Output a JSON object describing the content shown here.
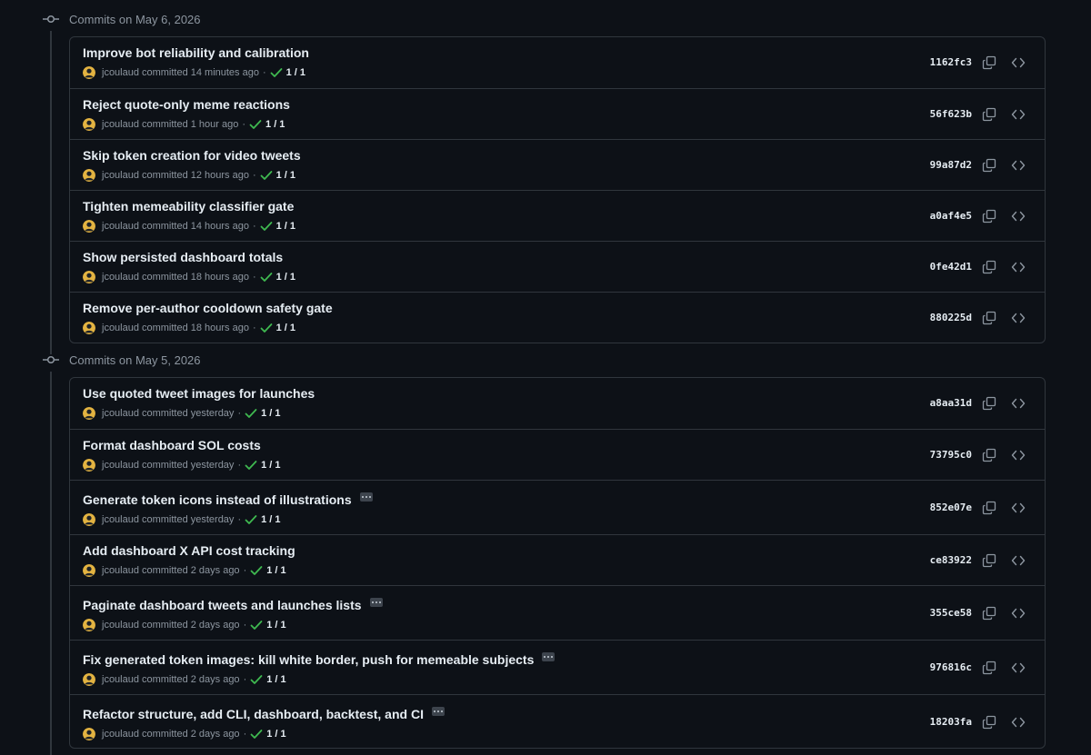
{
  "groups": [
    {
      "label": "Commits on May 6, 2026",
      "commits": [
        {
          "title": "Improve bot reliability and calibration",
          "author": "jcoulaud",
          "committed": "committed",
          "time": "14 minutes ago",
          "sep": "·",
          "status": "1 / 1",
          "sha": "1162fc3",
          "has_ellipsis": false
        },
        {
          "title": "Reject quote-only meme reactions",
          "author": "jcoulaud",
          "committed": "committed",
          "time": "1 hour ago",
          "sep": "·",
          "status": "1 / 1",
          "sha": "56f623b",
          "has_ellipsis": false
        },
        {
          "title": "Skip token creation for video tweets",
          "author": "jcoulaud",
          "committed": "committed",
          "time": "12 hours ago",
          "sep": "·",
          "status": "1 / 1",
          "sha": "99a87d2",
          "has_ellipsis": false
        },
        {
          "title": "Tighten memeability classifier gate",
          "author": "jcoulaud",
          "committed": "committed",
          "time": "14 hours ago",
          "sep": "·",
          "status": "1 / 1",
          "sha": "a0af4e5",
          "has_ellipsis": false
        },
        {
          "title": "Show persisted dashboard totals",
          "author": "jcoulaud",
          "committed": "committed",
          "time": "18 hours ago",
          "sep": "·",
          "status": "1 / 1",
          "sha": "0fe42d1",
          "has_ellipsis": false
        },
        {
          "title": "Remove per-author cooldown safety gate",
          "author": "jcoulaud",
          "committed": "committed",
          "time": "18 hours ago",
          "sep": "·",
          "status": "1 / 1",
          "sha": "880225d",
          "has_ellipsis": false
        }
      ]
    },
    {
      "label": "Commits on May 5, 2026",
      "commits": [
        {
          "title": "Use quoted tweet images for launches",
          "author": "jcoulaud",
          "committed": "committed",
          "time": "yesterday",
          "sep": "·",
          "status": "1 / 1",
          "sha": "a8aa31d",
          "has_ellipsis": false
        },
        {
          "title": "Format dashboard SOL costs",
          "author": "jcoulaud",
          "committed": "committed",
          "time": "yesterday",
          "sep": "·",
          "status": "1 / 1",
          "sha": "73795c0",
          "has_ellipsis": false
        },
        {
          "title": "Generate token icons instead of illustrations",
          "author": "jcoulaud",
          "committed": "committed",
          "time": "yesterday",
          "sep": "·",
          "status": "1 / 1",
          "sha": "852e07e",
          "has_ellipsis": true
        },
        {
          "title": "Add dashboard X API cost tracking",
          "author": "jcoulaud",
          "committed": "committed",
          "time": "2 days ago",
          "sep": "·",
          "status": "1 / 1",
          "sha": "ce83922",
          "has_ellipsis": false
        },
        {
          "title": "Paginate dashboard tweets and launches lists",
          "author": "jcoulaud",
          "committed": "committed",
          "time": "2 days ago",
          "sep": "·",
          "status": "1 / 1",
          "sha": "355ce58",
          "has_ellipsis": true
        },
        {
          "title": "Fix generated token images: kill white border, push for memeable subjects",
          "author": "jcoulaud",
          "committed": "committed",
          "time": "2 days ago",
          "sep": "·",
          "status": "1 / 1",
          "sha": "976816c",
          "has_ellipsis": true
        },
        {
          "title": "Refactor structure, add CLI, dashboard, backtest, and CI",
          "author": "jcoulaud",
          "committed": "committed",
          "time": "2 days ago",
          "sep": "·",
          "status": "1 / 1",
          "sha": "18203fa",
          "has_ellipsis": true
        }
      ]
    }
  ],
  "icons": {
    "commit_node": "git-commit-icon",
    "check": "check-icon",
    "copy": "copy-icon",
    "browse": "code-icon",
    "more": "ellipsis-icon"
  },
  "colors": {
    "background": "#0d1117",
    "border": "#30363d",
    "text_primary": "#e6edf3",
    "text_muted": "#8d96a0",
    "success": "#3fb950"
  }
}
